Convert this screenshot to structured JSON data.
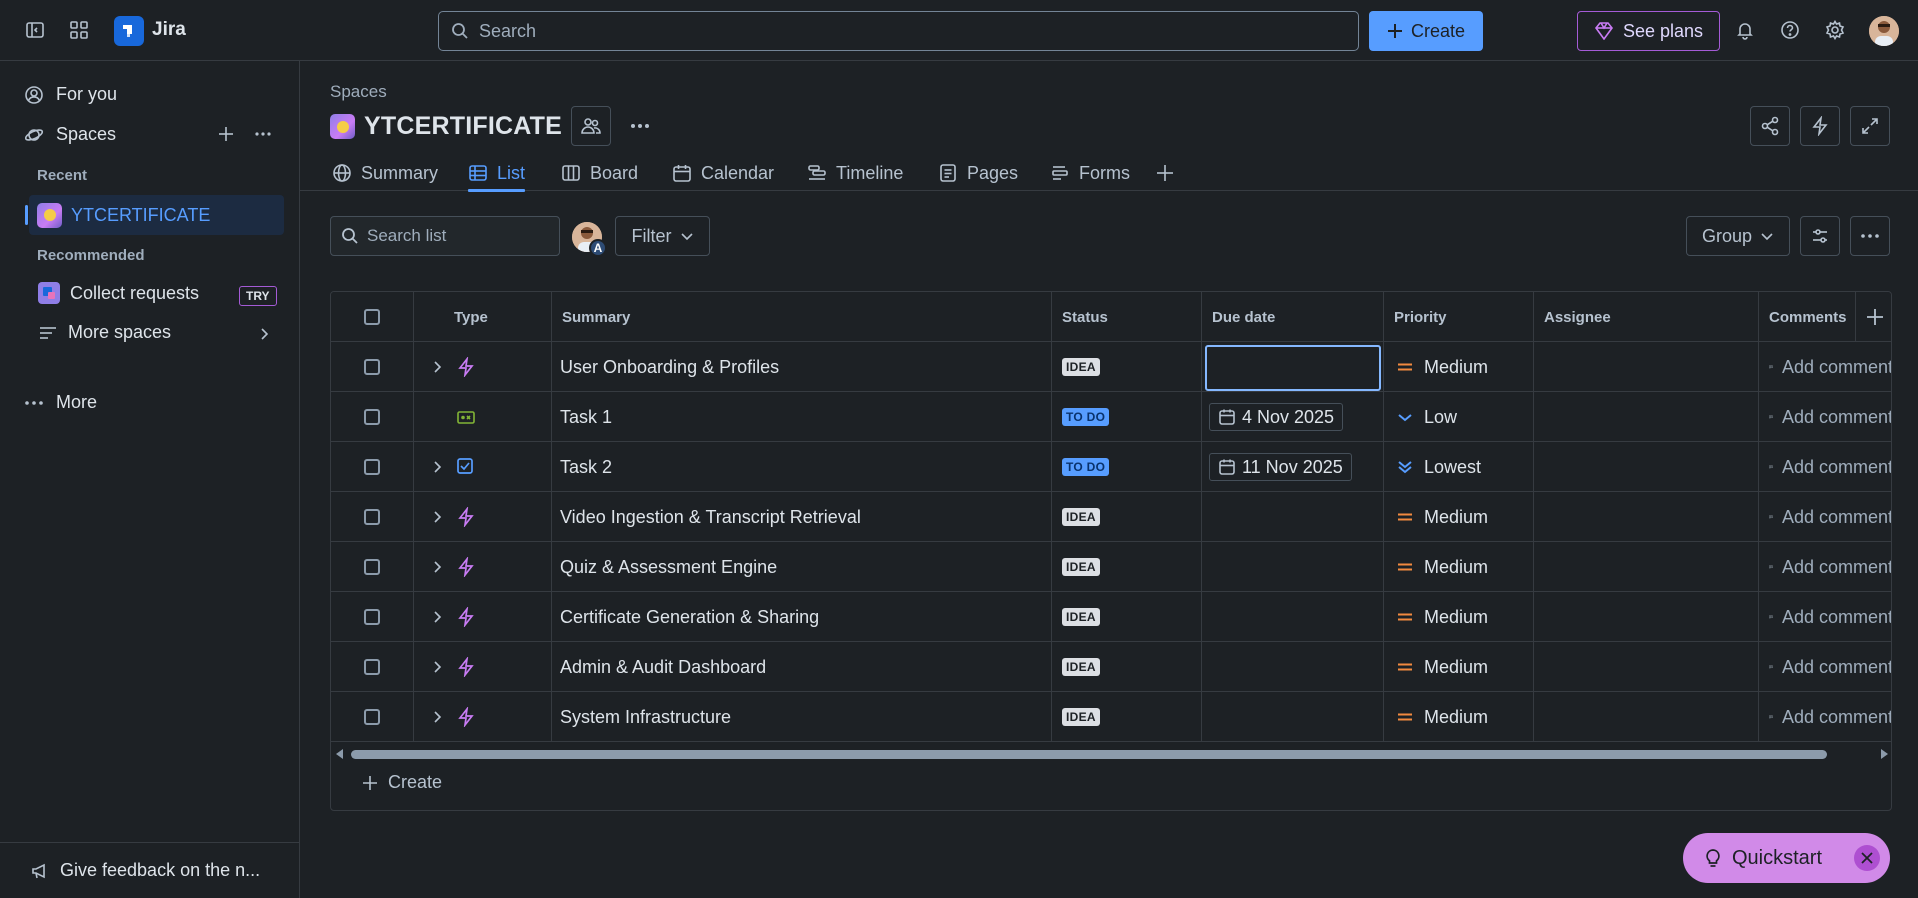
{
  "topbar": {
    "app_name": "Jira",
    "search_placeholder": "Search",
    "create_label": "Create",
    "see_plans_label": "See plans"
  },
  "sidebar": {
    "for_you": "For you",
    "spaces": "Spaces",
    "recent_heading": "Recent",
    "recent_project": "YTCERTIFICATE",
    "recommended_heading": "Recommended",
    "collect_requests": "Collect requests",
    "try_badge": "TRY",
    "more_spaces": "More spaces",
    "more": "More",
    "feedback": "Give feedback on the n..."
  },
  "header": {
    "breadcrumb": "Spaces",
    "project_name": "YTCERTIFICATE"
  },
  "tabs": [
    {
      "label": "Summary",
      "icon": "globe-icon"
    },
    {
      "label": "List",
      "icon": "list-icon",
      "active": true
    },
    {
      "label": "Board",
      "icon": "board-icon"
    },
    {
      "label": "Calendar",
      "icon": "calendar-icon"
    },
    {
      "label": "Timeline",
      "icon": "timeline-icon"
    },
    {
      "label": "Pages",
      "icon": "pages-icon"
    },
    {
      "label": "Forms",
      "icon": "forms-icon"
    }
  ],
  "toolbar": {
    "search_placeholder": "Search list",
    "avatar_letter": "A",
    "filter_label": "Filter",
    "group_label": "Group"
  },
  "table": {
    "columns": [
      "Type",
      "Summary",
      "Status",
      "Due date",
      "Priority",
      "Assignee",
      "Comments"
    ],
    "rows": [
      {
        "type": "epic",
        "summary": "User Onboarding & Profiles",
        "status": "IDEA",
        "due": "",
        "priority": "Medium",
        "comment": "Add comment",
        "expandable": true
      },
      {
        "type": "story",
        "summary": "Task 1",
        "status": "TO DO",
        "due": "4 Nov 2025",
        "priority": "Low",
        "comment": "Add comment",
        "expandable": false
      },
      {
        "type": "task",
        "summary": "Task 2",
        "status": "TO DO",
        "due": "11 Nov 2025",
        "priority": "Lowest",
        "comment": "Add comment",
        "expandable": true
      },
      {
        "type": "epic",
        "summary": "Video Ingestion & Transcript Retrieval",
        "status": "IDEA",
        "due": "",
        "priority": "Medium",
        "comment": "Add comment",
        "expandable": true
      },
      {
        "type": "epic",
        "summary": "Quiz & Assessment Engine",
        "status": "IDEA",
        "due": "",
        "priority": "Medium",
        "comment": "Add comment",
        "expandable": true
      },
      {
        "type": "epic",
        "summary": "Certificate Generation & Sharing",
        "status": "IDEA",
        "due": "",
        "priority": "Medium",
        "comment": "Add comment",
        "expandable": true
      },
      {
        "type": "epic",
        "summary": "Admin & Audit Dashboard",
        "status": "IDEA",
        "due": "",
        "priority": "Medium",
        "comment": "Add comment",
        "expandable": true
      },
      {
        "type": "epic",
        "summary": "System Infrastructure",
        "status": "IDEA",
        "due": "",
        "priority": "Medium",
        "comment": "Add comment",
        "expandable": true
      }
    ],
    "create_label": "Create"
  },
  "quickstart": {
    "label": "Quickstart"
  },
  "colors": {
    "accent": "#579dff",
    "medium_priority": "#f38a3f",
    "low_priority": "#579dff",
    "epic": "#c97cf4",
    "story": "#82b536"
  }
}
